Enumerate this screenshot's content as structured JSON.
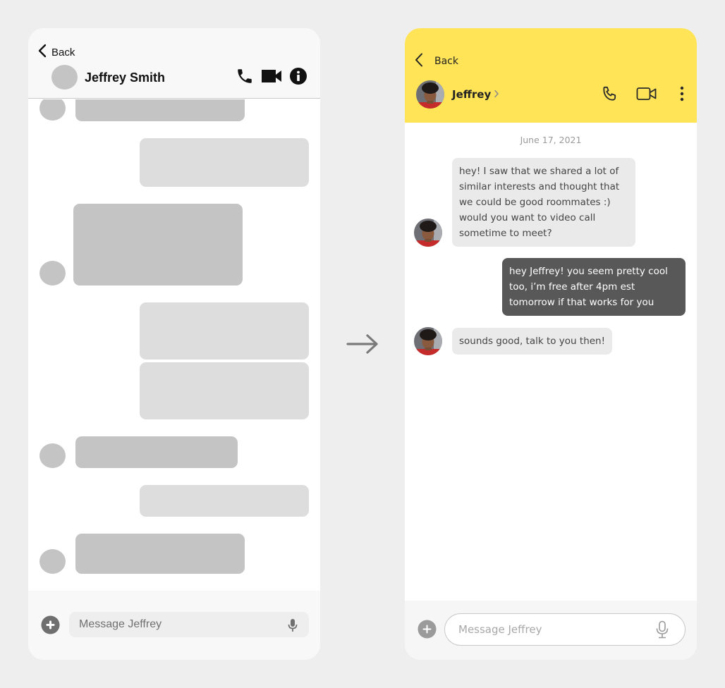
{
  "wireframe": {
    "header": {
      "back_label": "Back",
      "contact_name": "Jeffrey Smith",
      "icons": [
        "chevron-left-icon",
        "phone-icon",
        "video-camera-icon",
        "info-icon"
      ]
    },
    "skeleton_messages": [
      {
        "direction": "incoming",
        "lines": 1,
        "with_avatar": true
      },
      {
        "direction": "outgoing",
        "lines": 2
      },
      {
        "direction": "incoming",
        "lines": 4,
        "with_avatar": true
      },
      {
        "direction": "outgoing",
        "lines": 2
      },
      {
        "direction": "outgoing",
        "lines": 2
      },
      {
        "direction": "incoming",
        "lines": 1,
        "with_avatar": true
      },
      {
        "direction": "outgoing",
        "lines": 1
      },
      {
        "direction": "incoming",
        "lines": 1,
        "with_avatar": true
      }
    ],
    "composer": {
      "placeholder": "Message Jeffrey",
      "icons": [
        "plus-circle-icon",
        "microphone-icon"
      ]
    }
  },
  "transition": {
    "icon": "arrow-right-icon"
  },
  "design": {
    "accent_color": "#ffe457",
    "header": {
      "back_label": "Back",
      "contact_name": "Jeffrey",
      "icons": [
        "chevron-left-icon",
        "chevron-right-icon",
        "phone-icon",
        "video-camera-icon",
        "more-vertical-icon"
      ]
    },
    "date_label": "June 17, 2021",
    "messages": [
      {
        "direction": "incoming",
        "text": "hey! I saw that we shared a lot of similar interests and thought that we could be good roommates :) would you want to video call sometime to meet?"
      },
      {
        "direction": "outgoing",
        "text": "hey Jeffrey! you seem pretty cool too, i’m free after 4pm est tomorrow if that works for you"
      },
      {
        "direction": "incoming",
        "text": "sounds good, talk to you then!"
      }
    ],
    "composer": {
      "placeholder": "Message Jeffrey",
      "icons": [
        "plus-circle-icon",
        "microphone-icon"
      ]
    }
  }
}
